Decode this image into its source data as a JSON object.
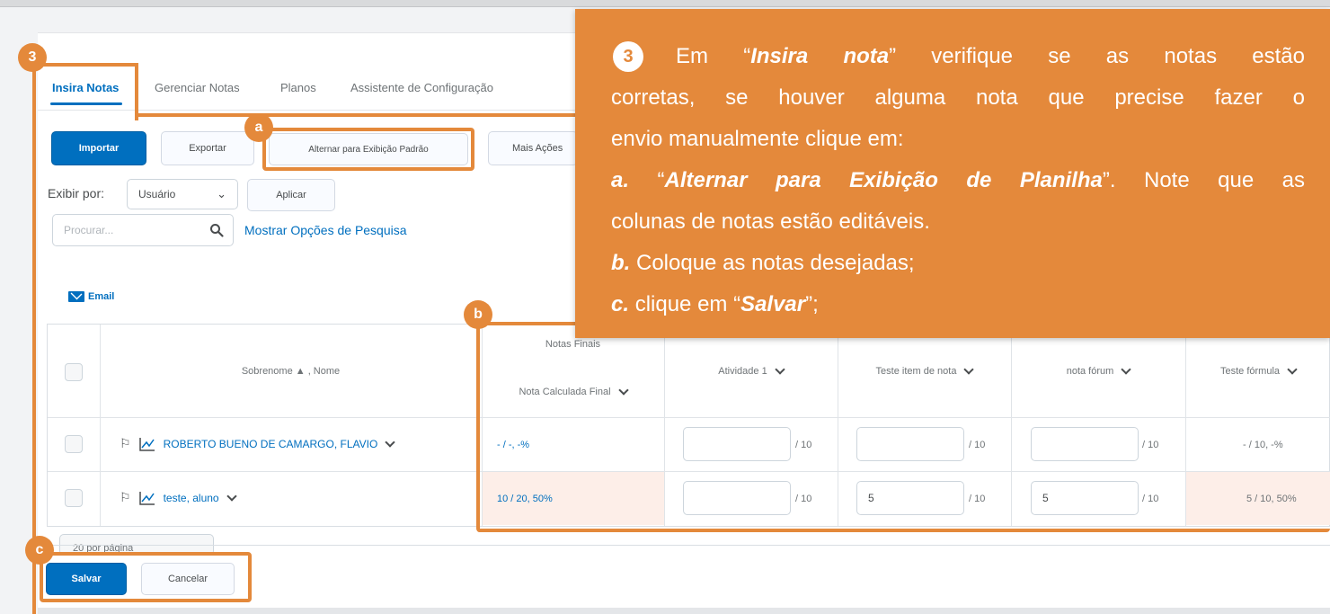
{
  "tabs": [
    {
      "label": "Insira Notas",
      "active": true
    },
    {
      "label": "Gerenciar Notas"
    },
    {
      "label": "Planos"
    },
    {
      "label": "Assistente de Configuração"
    }
  ],
  "toolbar": {
    "import_label": "Importar",
    "export_label": "Exportar",
    "toggle_view_label": "Alternar para Exibição Padrão",
    "more_actions_label": "Mais Ações"
  },
  "filter": {
    "view_by_label": "Exibir por:",
    "view_by_value": "Usuário",
    "apply_label": "Aplicar",
    "search_placeholder": "Procurar...",
    "show_search_options": "Mostrar Opções de Pesquisa"
  },
  "email_label": "Email",
  "grid": {
    "name_header": "Sobrenome ▲ , Nome",
    "final_group_header": "Notas Finais",
    "final_header": "Nota Calculada Final",
    "columns": [
      "Atividade 1",
      "Teste item de nota",
      "nota fórum",
      "Teste fórmula"
    ],
    "rows": [
      {
        "name": "ROBERTO BUENO DE CAMARGO, FLAVIO",
        "final": "- / -, -%",
        "grades": [
          "",
          "",
          ""
        ],
        "out_of": [
          "/ 10",
          "/ 10",
          "/ 10"
        ],
        "formula": "- / 10, -%"
      },
      {
        "name": "teste, aluno",
        "final": "10 / 20, 50%",
        "grades": [
          "",
          "5",
          "5"
        ],
        "out_of": [
          "/ 10",
          "/ 10",
          "/ 10"
        ],
        "formula": "5 / 10, 50%"
      }
    ]
  },
  "pager_label": "20 por página",
  "footer": {
    "save_label": "Salvar",
    "cancel_label": "Cancelar"
  },
  "annotations": {
    "badge_3": "3",
    "badge_a": "a",
    "badge_b": "b",
    "badge_c": "c",
    "callout_number": "3",
    "callout_lines": {
      "l1_a": "Em “",
      "l1_b": "Insira nota",
      "l1_c": "” verifique se as notas estão",
      "l2": "corretas, se houver alguma nota que precise fazer o",
      "l3": "envio manualmente clique em:",
      "l4_a": "a.",
      "l4_b": "“",
      "l4_c": "Alternar para Exibição de Planilha",
      "l4_d": "”. Note que as",
      "l5": "colunas de notas estão editáveis.",
      "l6_a": "b.",
      "l6_b": "Coloque as notas desejadas;",
      "l7_a": "c.",
      "l7_b": "clique em “",
      "l7_c": "Salvar",
      "l7_d": "”;"
    }
  },
  "colors": {
    "accent": "#006fbf",
    "annotation": "#e4893b",
    "highlight_row": "#fdeee8"
  }
}
